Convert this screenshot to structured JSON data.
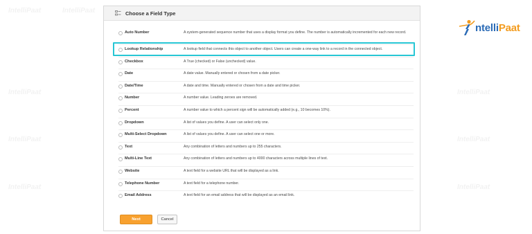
{
  "panel": {
    "title": "Choose a Field Type"
  },
  "fields": [
    {
      "label": "Auto Number",
      "description": "A system-generated sequence number that uses a display format you define. The number is automatically incremented for each new record."
    },
    {
      "label": "Lookup Relationship",
      "description": "A lookup field that connects this object to another object. Users can create a one-way link to a record in the connected object."
    },
    {
      "label": "Checkbox",
      "description": "A True (checked) or False (unchecked) value."
    },
    {
      "label": "Date",
      "description": "A date value. Manually entered or chosen from a date picker."
    },
    {
      "label": "Date/Time",
      "description": "A date and time. Manually entered or chosen from a date and time picker."
    },
    {
      "label": "Number",
      "description": "A number value. Leading zeroes are removed."
    },
    {
      "label": "Percent",
      "description": "A number value to which a percent sign will be automatically added (e.g., 10 becomes 10%)."
    },
    {
      "label": "Dropdown",
      "description": "A list of values you define. A user can select only one."
    },
    {
      "label": "Multi-Select Dropdown",
      "description": "A list of values you define. A user can select one or more."
    },
    {
      "label": "Text",
      "description": "Any combination of letters and numbers up to 255 characters."
    },
    {
      "label": "Multi-Line Text",
      "description": "Any combination of letters and numbers up to 4000 characters across multiple lines of text."
    },
    {
      "label": "Website",
      "description": "A text field for a website URL that will be displayed as a link."
    },
    {
      "label": "Telephone Number",
      "description": "A text field for a telephone number."
    },
    {
      "label": "Email Address",
      "description": "A text field for an email address that will be displayed as an email link."
    }
  ],
  "buttons": {
    "next": "Next",
    "cancel": "Cancel"
  },
  "brand": {
    "part1": "ntelli",
    "part2": "Paat"
  },
  "watermark": "IntelliPaat",
  "colors": {
    "highlight": "#27c6d4",
    "next_button": "#f8a12f",
    "brand_blue": "#2b6bb6",
    "brand_orange": "#f39c1f"
  }
}
